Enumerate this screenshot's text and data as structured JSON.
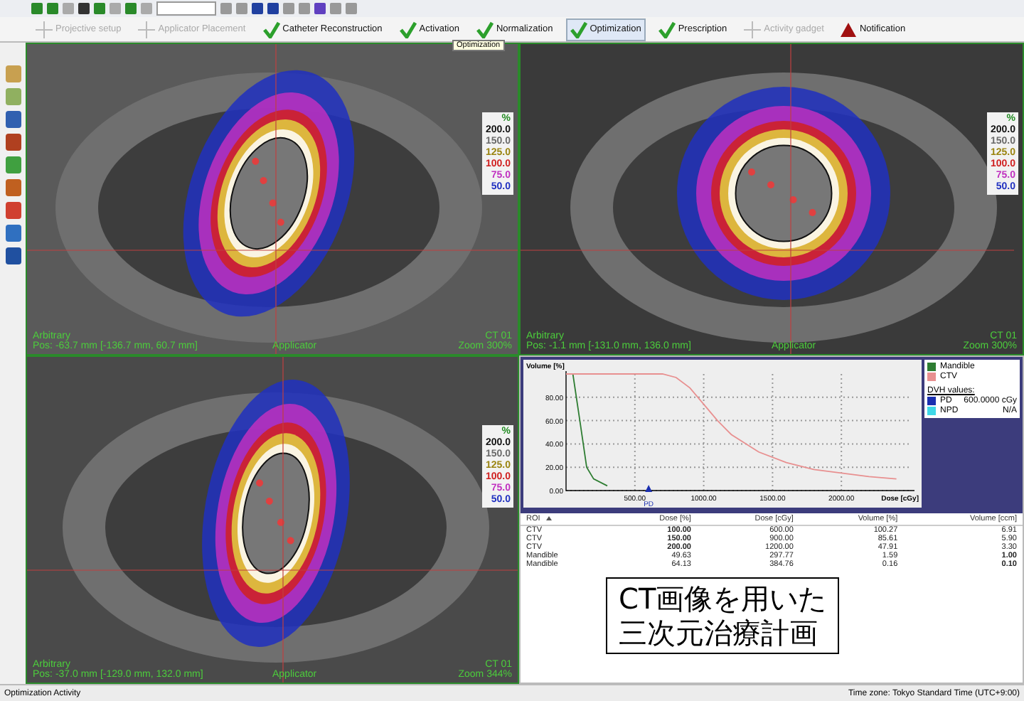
{
  "workflow": [
    {
      "label": "Projective setup",
      "kind": "step",
      "disabled": true,
      "selected": false
    },
    {
      "label": "Applicator Placement",
      "kind": "step",
      "disabled": true,
      "selected": false
    },
    {
      "label": "Catheter Reconstruction",
      "kind": "step",
      "disabled": false,
      "selected": false
    },
    {
      "label": "Activation",
      "kind": "step",
      "disabled": false,
      "selected": false
    },
    {
      "label": "Normalization",
      "kind": "step",
      "disabled": false,
      "selected": false
    },
    {
      "label": "Optimization",
      "kind": "step",
      "disabled": false,
      "selected": true
    },
    {
      "label": "Prescription",
      "kind": "step",
      "disabled": false,
      "selected": false
    },
    {
      "label": "Activity gadget",
      "kind": "step",
      "disabled": true,
      "selected": false
    },
    {
      "label": "Notification",
      "kind": "alert",
      "disabled": false,
      "selected": false
    }
  ],
  "tooltip": "Optimization",
  "viewports": [
    {
      "orientation": "Arbitrary",
      "pos": "Pos: -63.7 mm [-136.7 mm, 60.7 mm]",
      "applicator": "Applicator",
      "series": "CT 01",
      "zoom": "Zoom 300%",
      "legend_unit": "%",
      "legend": [
        {
          "label": "200.0",
          "color": "#111111"
        },
        {
          "label": "150.0",
          "color": "#6a6a6a"
        },
        {
          "label": "125.0",
          "color": "#9a8410"
        },
        {
          "label": "100.0",
          "color": "#d02020"
        },
        {
          "label": "75.0",
          "color": "#c030c0"
        },
        {
          "label": "50.0",
          "color": "#2030c0"
        }
      ]
    },
    {
      "orientation": "Arbitrary",
      "pos": "Pos: -1.1 mm [-131.0 mm, 136.0 mm]",
      "applicator": "Applicator",
      "series": "CT 01",
      "zoom": "Zoom 300%",
      "legend_unit": "%",
      "legend": [
        {
          "label": "200.0",
          "color": "#111111"
        },
        {
          "label": "150.0",
          "color": "#6a6a6a"
        },
        {
          "label": "125.0",
          "color": "#9a8410"
        },
        {
          "label": "100.0",
          "color": "#d02020"
        },
        {
          "label": "75.0",
          "color": "#c030c0"
        },
        {
          "label": "50.0",
          "color": "#2030c0"
        }
      ]
    },
    {
      "orientation": "Arbitrary",
      "pos": "Pos: -37.0 mm [-129.0 mm, 132.0 mm]",
      "applicator": "Applicator",
      "series": "CT 01",
      "zoom": "Zoom 344%",
      "legend_unit": "%",
      "legend": [
        {
          "label": "200.0",
          "color": "#111111"
        },
        {
          "label": "150.0",
          "color": "#6a6a6a"
        },
        {
          "label": "125.0",
          "color": "#9a8410"
        },
        {
          "label": "100.0",
          "color": "#d02020"
        },
        {
          "label": "75.0",
          "color": "#c030c0"
        },
        {
          "label": "50.0",
          "color": "#2030c0"
        }
      ]
    }
  ],
  "dvh": {
    "chart_data": {
      "type": "line",
      "xlabel": "Dose [cGy]",
      "ylabel": "Volume [%]",
      "x": [
        0,
        50,
        100,
        150,
        200,
        300,
        400,
        500,
        600,
        700,
        800,
        900,
        1000,
        1100,
        1200,
        1400,
        1600,
        1800,
        2000,
        2200,
        2400
      ],
      "series": [
        {
          "name": "Mandible",
          "color": "#2e7d32",
          "values": [
            100,
            100,
            60,
            20,
            10,
            4,
            null,
            null,
            null,
            null,
            null,
            null,
            null,
            null,
            null,
            null,
            null,
            null,
            null,
            null,
            null
          ]
        },
        {
          "name": "CTV",
          "color": "#e89090",
          "values": [
            100,
            100,
            100,
            100,
            100,
            100,
            100,
            100,
            100,
            100,
            97,
            88,
            74,
            60,
            48,
            33,
            24,
            18,
            15,
            12,
            10
          ]
        }
      ],
      "xlim": [
        0,
        2500
      ],
      "ylim": [
        0,
        100
      ],
      "xticks": [
        {
          "value": 500,
          "label": "500.00"
        },
        {
          "value": 1000,
          "label": "1000.00"
        },
        {
          "value": 1500,
          "label": "1500.00"
        },
        {
          "value": 2000,
          "label": "2000.00"
        }
      ],
      "yticks": [
        {
          "value": 0,
          "label": "0.00"
        },
        {
          "value": 20,
          "label": "20.00"
        },
        {
          "value": 40,
          "label": "40.00"
        },
        {
          "value": 60,
          "label": "60.00"
        },
        {
          "value": 80,
          "label": "80.00"
        }
      ],
      "grid": true
    },
    "pd_marker": "PD",
    "values_title": "DVH values:",
    "values": [
      {
        "label": "PD",
        "value": "600.0000 cGy",
        "color": "#1a2fb0"
      },
      {
        "label": "NPD",
        "value": "N/A",
        "color": "#40d8e8"
      }
    ]
  },
  "table": {
    "columns": [
      "ROI",
      "Dose [%]",
      "Dose [cGy]",
      "Volume [%]",
      "Volume [ccm]"
    ],
    "sort_ascending": true,
    "rows": [
      {
        "cells": [
          "CTV",
          "100.00",
          "600.00",
          "100.27",
          "6.91"
        ],
        "bold": [
          false,
          true,
          false,
          false,
          false
        ]
      },
      {
        "cells": [
          "CTV",
          "150.00",
          "900.00",
          "85.61",
          "5.90"
        ],
        "bold": [
          false,
          true,
          false,
          false,
          false
        ]
      },
      {
        "cells": [
          "CTV",
          "200.00",
          "1200.00",
          "47.91",
          "3.30"
        ],
        "bold": [
          false,
          true,
          false,
          false,
          false
        ]
      },
      {
        "cells": [
          "Mandible",
          "49.63",
          "297.77",
          "1.59",
          "1.00"
        ],
        "bold": [
          false,
          false,
          false,
          false,
          true
        ]
      },
      {
        "cells": [
          "Mandible",
          "64.13",
          "384.76",
          "0.16",
          "0.10"
        ],
        "bold": [
          false,
          false,
          false,
          false,
          true
        ]
      }
    ]
  },
  "caption": [
    "CT画像を用いた",
    "三次元治療計画"
  ],
  "status_bar": {
    "activity": "Optimization Activity",
    "timezone": "Time zone: Tokyo Standard Time (UTC+9:00)"
  }
}
